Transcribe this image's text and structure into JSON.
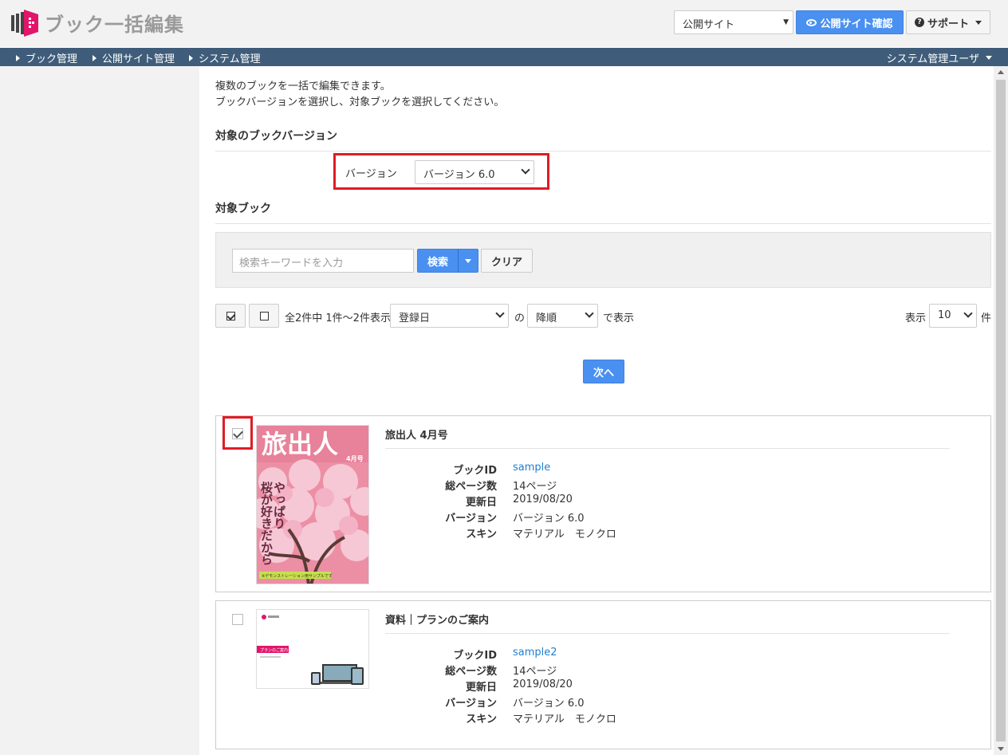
{
  "header": {
    "title": "ブック一括編集",
    "site_select": "公開サイト",
    "confirm_button": "公開サイト確認",
    "support_button": "サポート"
  },
  "nav": {
    "items": [
      "ブック管理",
      "公開サイト管理",
      "システム管理"
    ],
    "user": "システム管理ユーザ"
  },
  "intro": {
    "line1": "複数のブックを一括で編集できます。",
    "line2": "ブックバージョンを選択し、対象ブックを選択してください。"
  },
  "version_section": {
    "title": "対象のブックバージョン",
    "label": "バージョン",
    "selected": "バージョン 6.0"
  },
  "book_section": {
    "title": "対象ブック",
    "search_placeholder": "検索キーワードを入力",
    "search_button": "検索",
    "clear_button": "クリア"
  },
  "list_controls": {
    "count_text": "全2件中 1件〜2件表示",
    "sort_field": "登録日",
    "of_text": "の",
    "sort_order": "降順",
    "display_text": "で表示",
    "show_label": "表示",
    "per_page": "10",
    "unit": "件"
  },
  "next_button": "次へ",
  "books": [
    {
      "checked": true,
      "title": "旅出人 4月号",
      "book_id_label": "ブックID",
      "book_id": "sample",
      "pages_label": "総ページ数",
      "pages": "14ページ",
      "updated_label": "更新日",
      "updated": "2019/08/20",
      "version_label": "バージョン",
      "version": "バージョン 6.0",
      "skin_label": "スキン",
      "skin": "マテリアル　モノクロ",
      "cover": {
        "masthead": "旅出人",
        "issue": "4月号",
        "headline_1": "やっぱり",
        "headline_2": "桜が好きだから",
        "banner": "※デモンストレーション用サンプルです"
      }
    },
    {
      "checked": false,
      "title": "資料｜プランのご案内",
      "book_id_label": "ブックID",
      "book_id": "sample2",
      "pages_label": "総ページ数",
      "pages": "14ページ",
      "updated_label": "更新日",
      "updated": "2019/08/20",
      "version_label": "バージョン",
      "version": "バージョン 6.0",
      "skin_label": "スキン",
      "skin": "マテリアル　モノクロ",
      "cover": {
        "tag": "プランのご案内"
      }
    }
  ],
  "colors": {
    "nav_bg": "#3f5d7a",
    "primary": "#4a90f0",
    "highlight": "#e01c24",
    "link": "#1f7fcf",
    "logo": "#e2156b"
  }
}
